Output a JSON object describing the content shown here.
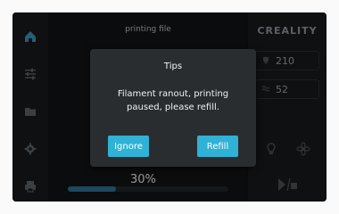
{
  "sidebar": {
    "items": [
      {
        "name": "home",
        "active": true
      },
      {
        "name": "tune"
      },
      {
        "name": "files"
      },
      {
        "name": "settings"
      },
      {
        "name": "printer"
      }
    ]
  },
  "print": {
    "file_name": "printing file",
    "progress_text": "30%",
    "progress_value": 30
  },
  "right_panel": {
    "brand": "CREALITY",
    "nozzle_temp": "210",
    "bed_temp": "52"
  },
  "dialog": {
    "title": "Tips",
    "message": "Filament ranout, printing paused, please refill.",
    "ignore_label": "Ignore",
    "refill_label": "Refill"
  },
  "colors": {
    "accent": "#2fb2d6",
    "dialog_bg": "#2a2d30",
    "screen_bg": "#0e1114"
  }
}
